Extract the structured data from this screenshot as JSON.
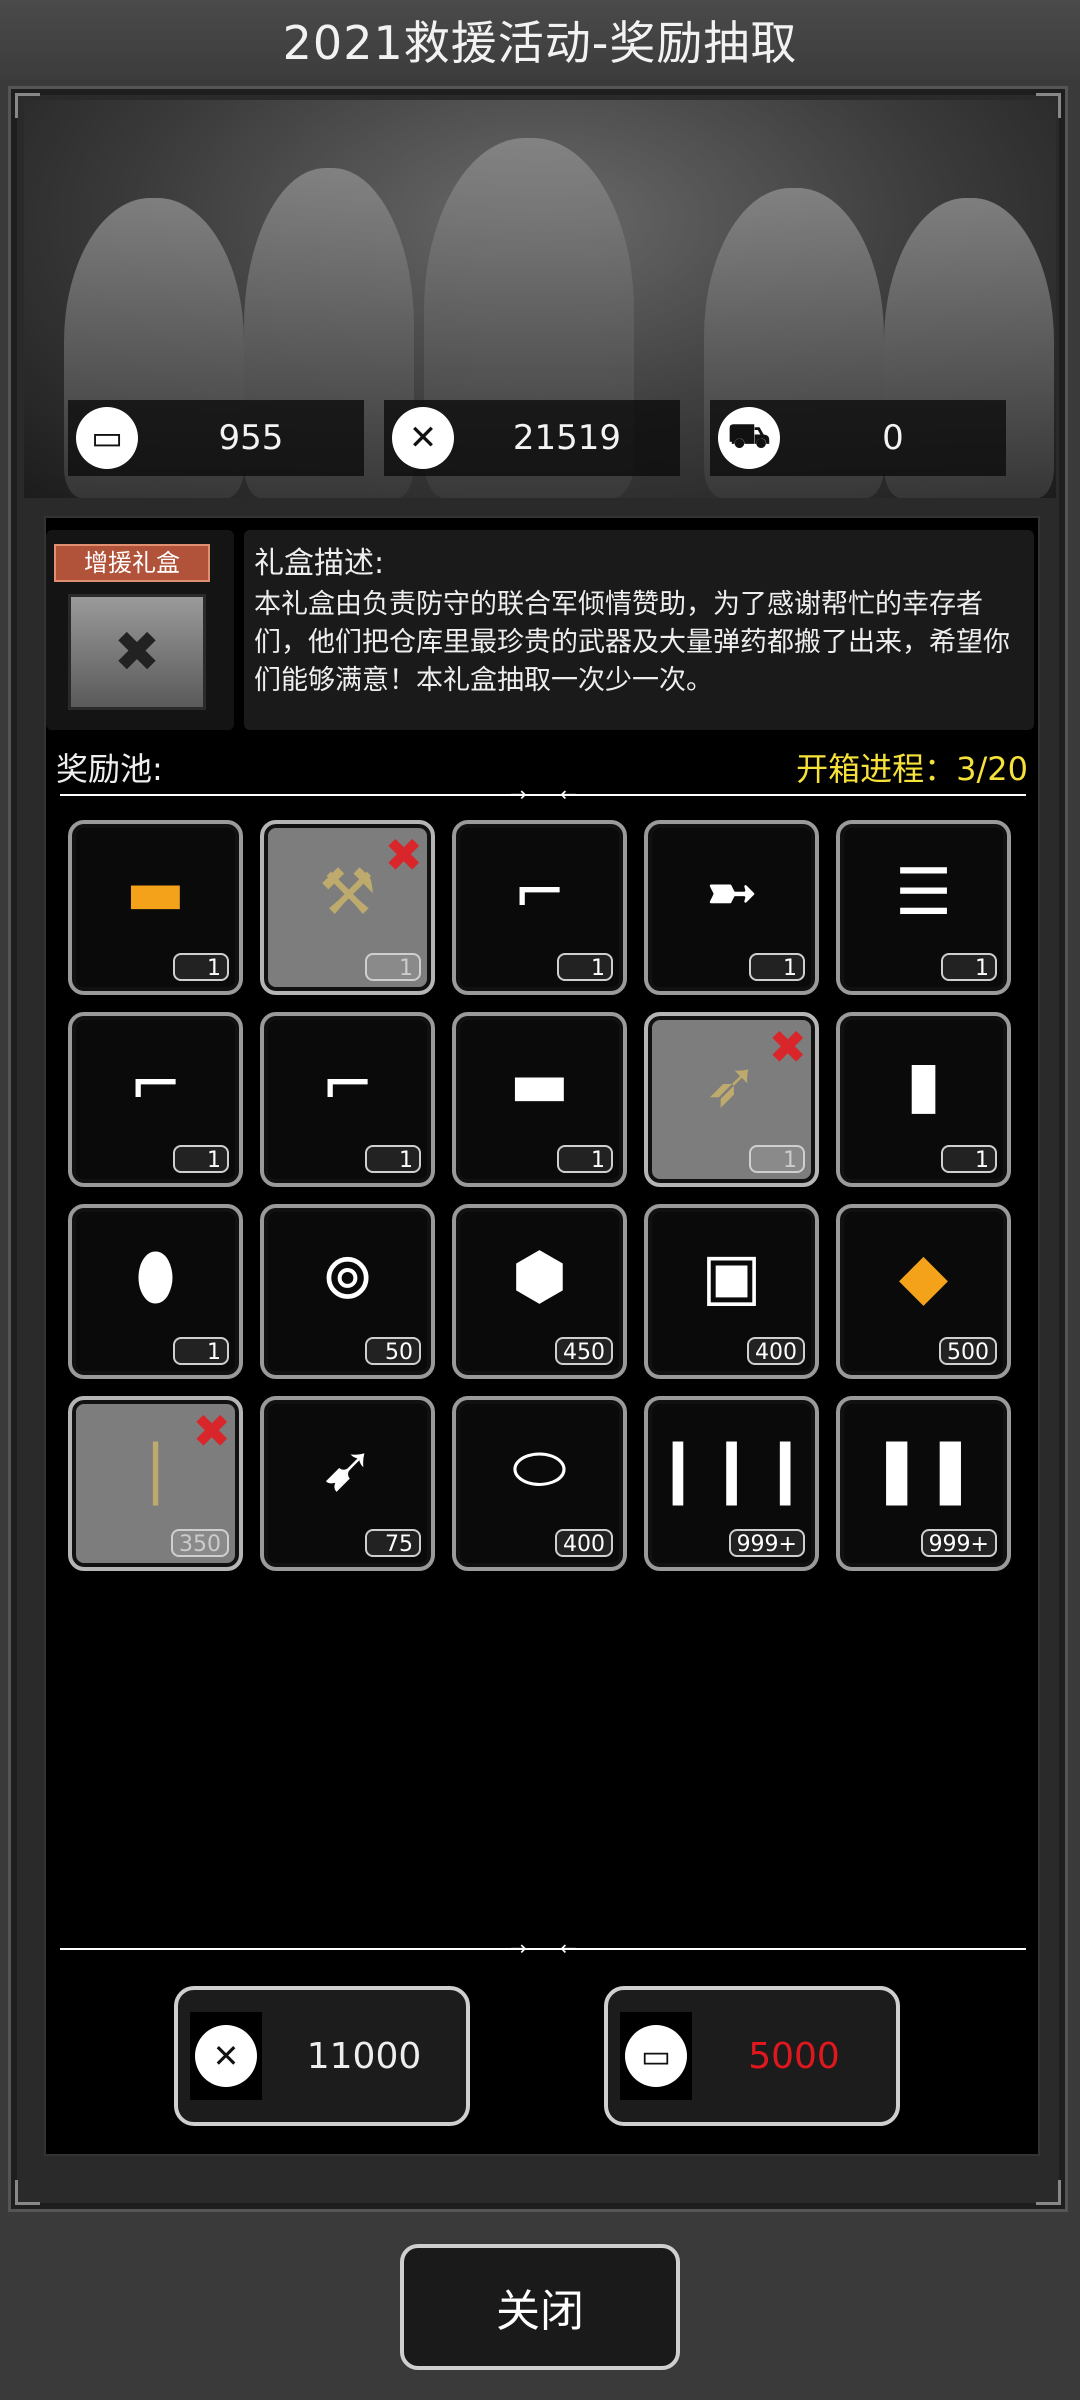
{
  "title": "2021救援活动-奖励抽取",
  "resources": [
    {
      "icon": "card-icon",
      "glyph": "▭",
      "value": "955"
    },
    {
      "icon": "badge-icon",
      "glyph": "✕",
      "value": "21519"
    },
    {
      "icon": "car-icon",
      "glyph": "⛟",
      "value": "0"
    }
  ],
  "gift": {
    "tag": "增援礼盒",
    "desc_title": "礼盒描述:",
    "desc_text": "本礼盒由负责防守的联合军倾情赞助，为了感谢帮忙的幸存者们，他们把仓库里最珍贵的武器及大量弹药都搬了出来，希望你们能够满意！本礼盒抽取一次少一次。"
  },
  "pool": {
    "label": "奖励池:",
    "progress": "开箱进程：3/20"
  },
  "items": [
    {
      "name": "gold-shotgun",
      "glyph": "▬",
      "count": "1",
      "claimed": false,
      "gold": true
    },
    {
      "name": "gold-hammer",
      "glyph": "⚒",
      "count": "1",
      "claimed": true,
      "gold": false
    },
    {
      "name": "sniper-rifle",
      "glyph": "⌐",
      "count": "1",
      "claimed": false,
      "gold": false
    },
    {
      "name": "rocket-launcher",
      "glyph": "➼",
      "count": "1",
      "claimed": false,
      "gold": false
    },
    {
      "name": "minigun",
      "glyph": "☰",
      "count": "1",
      "claimed": false,
      "gold": false
    },
    {
      "name": "grenade-launcher",
      "glyph": "⌐",
      "count": "1",
      "claimed": false,
      "gold": false
    },
    {
      "name": "assault-rifle",
      "glyph": "⌐",
      "count": "1",
      "claimed": false,
      "gold": false
    },
    {
      "name": "pump-shotgun",
      "glyph": "▬",
      "count": "1",
      "claimed": false,
      "gold": false
    },
    {
      "name": "spear-blade",
      "glyph": "➶",
      "count": "1",
      "claimed": true,
      "gold": false
    },
    {
      "name": "armor-plate",
      "glyph": "▮",
      "count": "1",
      "claimed": false,
      "gold": false
    },
    {
      "name": "riot-shield",
      "glyph": "⬮",
      "count": "1",
      "claimed": false,
      "gold": false
    },
    {
      "name": "flashbang",
      "glyph": "⊚",
      "count": "50",
      "claimed": false,
      "gold": false
    },
    {
      "name": "frag-grenade",
      "glyph": "⬢",
      "count": "450",
      "claimed": false,
      "gold": false
    },
    {
      "name": "incendiary-grenade",
      "glyph": "▣",
      "count": "400",
      "claimed": false,
      "gold": false
    },
    {
      "name": "gold-shell",
      "glyph": "◆",
      "count": "500",
      "claimed": false,
      "gold": true
    },
    {
      "name": "rifle-rounds",
      "glyph": "❘",
      "count": "350",
      "claimed": true,
      "gold": false
    },
    {
      "name": "rpg-rocket",
      "glyph": "➹",
      "count": "75",
      "claimed": false,
      "gold": false
    },
    {
      "name": "shotgun-shells",
      "glyph": "⬭",
      "count": "400",
      "claimed": false,
      "gold": false
    },
    {
      "name": "rifle-ammo",
      "glyph": "❙❙❙",
      "count": "999+",
      "claimed": false,
      "gold": false
    },
    {
      "name": "pistol-ammo",
      "glyph": "❚❚",
      "count": "999+",
      "claimed": false,
      "gold": false
    }
  ],
  "costs": [
    {
      "icon": "badge-icon",
      "glyph": "✕",
      "value": "11000",
      "red": false
    },
    {
      "icon": "card-icon",
      "glyph": "▭",
      "value": "5000",
      "red": true
    }
  ],
  "close_label": "关闭"
}
